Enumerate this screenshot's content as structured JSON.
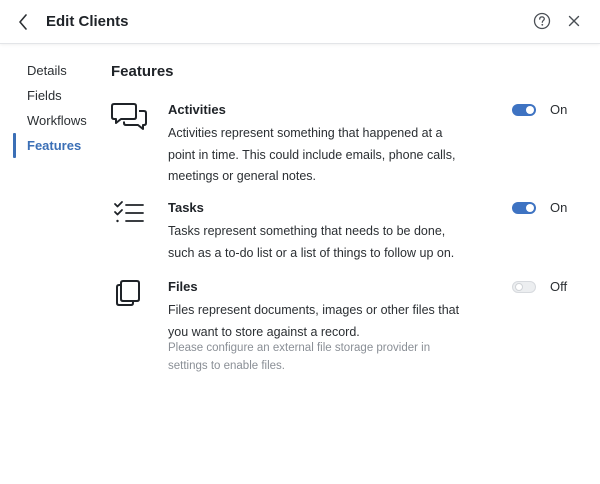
{
  "header": {
    "title": "Edit Clients"
  },
  "sidebar": {
    "items": [
      {
        "label": "Details"
      },
      {
        "label": "Fields"
      },
      {
        "label": "Workflows"
      },
      {
        "label": "Features",
        "active": true
      }
    ]
  },
  "main": {
    "section_title": "Features",
    "features": [
      {
        "name": "Activities",
        "icon": "chat-bubbles-icon",
        "description": "Activities represent something that happened at a point in time. This could include emails, phone calls, meetings or general notes.",
        "enabled": true,
        "toggle_label": "On"
      },
      {
        "name": "Tasks",
        "icon": "checklist-icon",
        "description": "Tasks represent something that needs to be done, such as a to-do list or a list of things to follow up on.",
        "enabled": true,
        "toggle_label": "On"
      },
      {
        "name": "Files",
        "icon": "files-icon",
        "description": "Files represent documents, images or other files that you want to store against a record.",
        "note": "Please configure an external file storage provider in settings to enable files.",
        "enabled": false,
        "toggle_label": "Off"
      }
    ]
  },
  "colors": {
    "accent": "#3b6fb6",
    "toggle_on": "#3e73c2",
    "muted_text": "#8a8f96"
  }
}
